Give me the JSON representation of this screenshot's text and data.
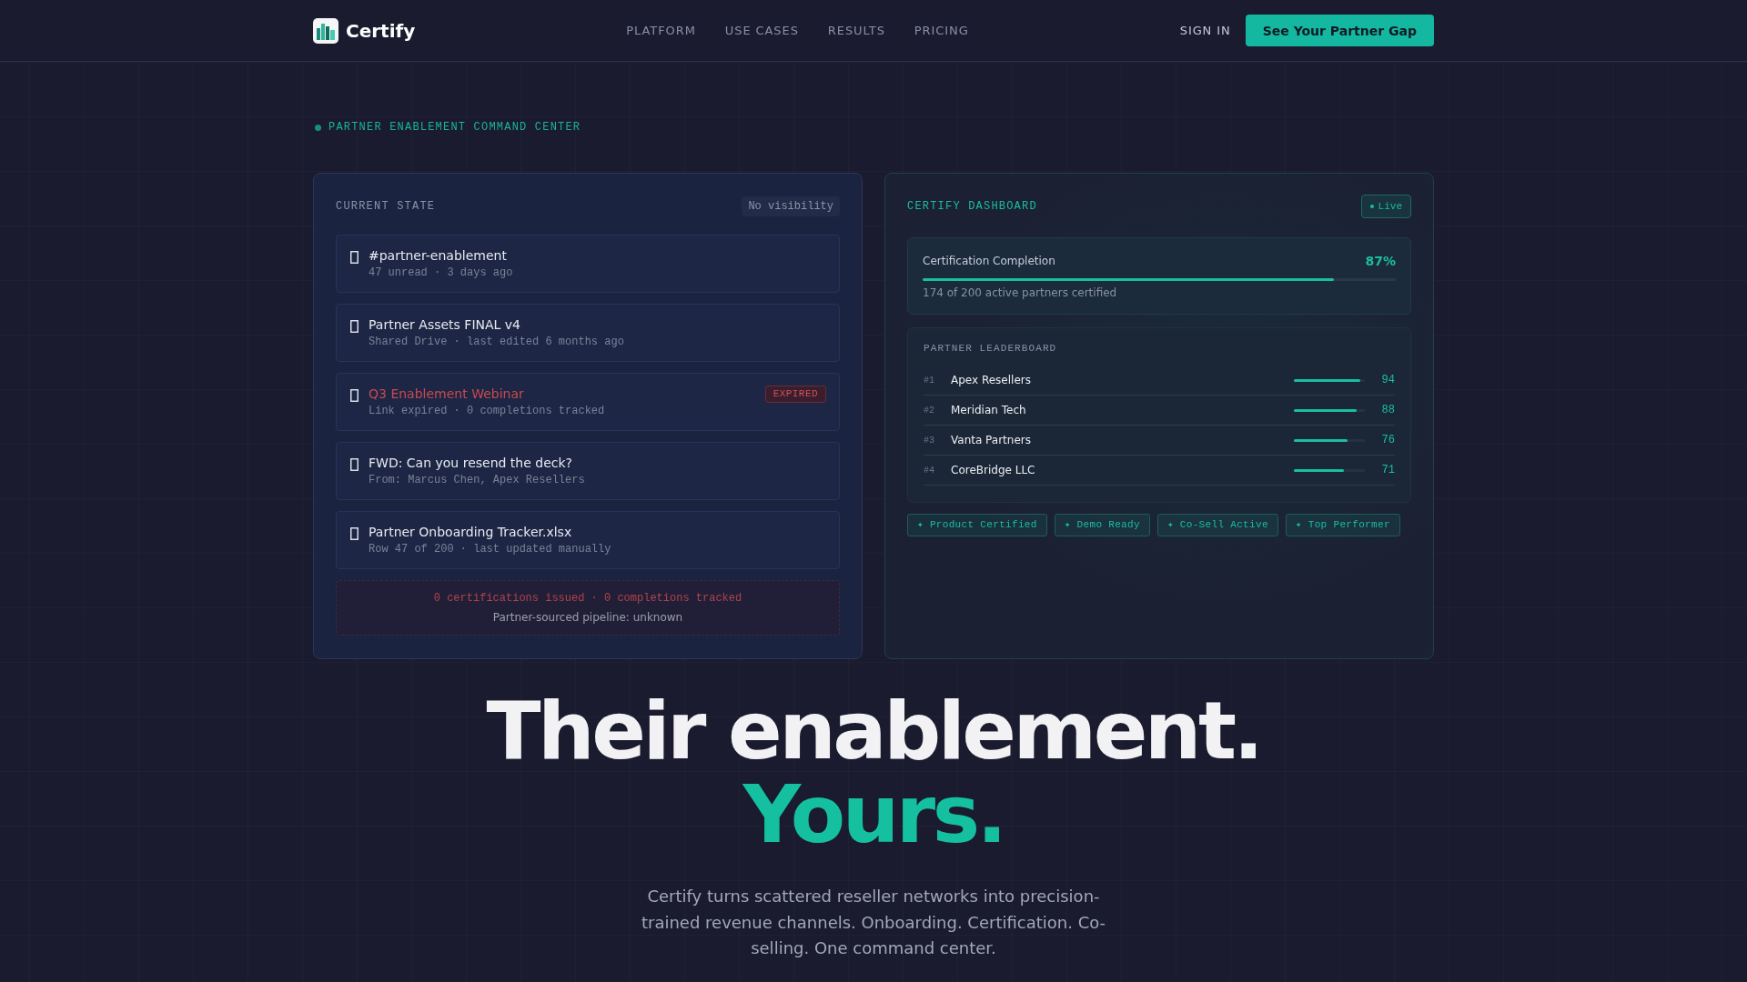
{
  "nav": {
    "brand": "Certify",
    "links": [
      "PLATFORM",
      "USE CASES",
      "RESULTS",
      "PRICING"
    ],
    "sign_in": "SIGN IN",
    "cta": "See Your Partner Gap"
  },
  "eyebrow": "PARTNER ENABLEMENT COMMAND CENTER",
  "current_state": {
    "title": "CURRENT STATE",
    "badge": "No visibility",
    "items": [
      {
        "title": "#partner-enablement",
        "meta": "47 unread · 3 days ago",
        "expired": false
      },
      {
        "title": "Partner Assets FINAL v4",
        "meta": "Shared Drive · last edited 6 months ago",
        "expired": false
      },
      {
        "title": "Q3 Enablement Webinar",
        "meta": "Link expired · 0 completions tracked",
        "expired": true,
        "badge": "EXPIRED"
      },
      {
        "title": "FWD: Can you resend the deck?",
        "meta": "From: Marcus Chen, Apex Resellers",
        "expired": false
      },
      {
        "title": "Partner Onboarding Tracker.xlsx",
        "meta": "Row 47 of 200 · last updated manually",
        "expired": false
      }
    ],
    "summary": {
      "stats": "0 certifications issued · 0 completions tracked",
      "pipeline": "Partner-sourced pipeline: unknown"
    }
  },
  "dashboard": {
    "title": "CERTIFY DASHBOARD",
    "status": "Live",
    "completion": {
      "label": "Certification Completion",
      "value": "87%",
      "level": 0.87,
      "detail": "174 of 200 active partners certified"
    },
    "leaderboard": {
      "title": "PARTNER LEADERBOARD",
      "rows": [
        {
          "rank": "#1",
          "name": "Apex Resellers",
          "level": 0.94,
          "score": "94"
        },
        {
          "rank": "#2",
          "name": "Meridian Tech",
          "level": 0.88,
          "score": "88"
        },
        {
          "rank": "#3",
          "name": "Vanta Partners",
          "level": 0.76,
          "score": "76"
        },
        {
          "rank": "#4",
          "name": "CoreBridge LLC",
          "level": 0.71,
          "score": "71"
        }
      ]
    },
    "tags": [
      "✦ Product Certified",
      "✦ Demo Ready",
      "✦ Co-Sell Active",
      "✦ Top Performer"
    ]
  },
  "hero": {
    "headline": "Their enablement.",
    "accent": "Yours.",
    "body": "Certify turns scattered reseller networks into precision-trained revenue channels. Onboarding. Certification. Co-selling. One command center."
  }
}
